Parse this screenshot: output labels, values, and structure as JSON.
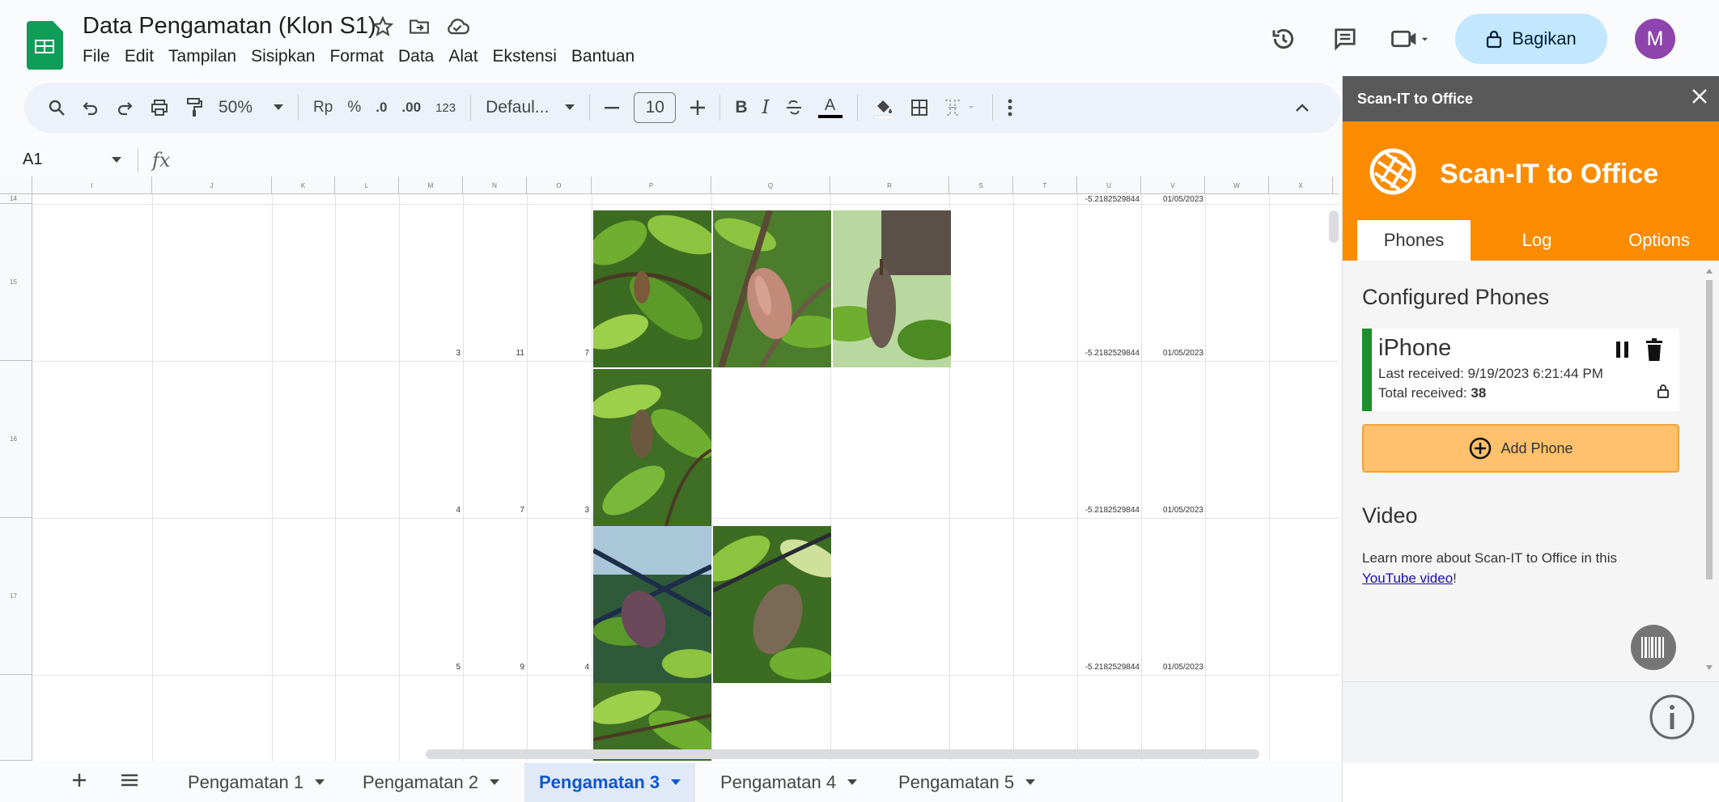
{
  "doc": {
    "title": "Data Pengamatan (Klon S1)",
    "menu": [
      "File",
      "Edit",
      "Tampilan",
      "Sisipkan",
      "Format",
      "Data",
      "Alat",
      "Ekstensi",
      "Bantuan"
    ]
  },
  "header": {
    "share_label": "Bagikan",
    "avatar_initial": "M",
    "icons": [
      "history-icon",
      "comment-icon",
      "video-call-icon",
      "lock-icon"
    ]
  },
  "toolbar": {
    "zoom": "50%",
    "currency": "Rp",
    "percent": "%",
    "decrease_decimal": ".0",
    "increase_decimal": ".00",
    "number_format": "123",
    "font": "Defaul...",
    "font_size": "10",
    "bold": "B",
    "italic": "I",
    "text_color": "A"
  },
  "formula_bar": {
    "name_box": "A1",
    "fx": "fx"
  },
  "grid": {
    "columns": [
      "I",
      "J",
      "K",
      "L",
      "M",
      "N",
      "O",
      "P",
      "Q",
      "R",
      "S",
      "T",
      "U",
      "V",
      "W",
      "X"
    ],
    "rows": [
      "14",
      "15",
      "16",
      "17"
    ],
    "cells": {
      "r14_u": "-5.2182529844",
      "r14_v": "01/05/2023",
      "r15_m": "3",
      "r15_n": "11",
      "r15_o": "7",
      "r15_u": "-5.2182529844",
      "r15_v": "01/05/2023",
      "r16_m": "4",
      "r16_n": "7",
      "r16_o": "3",
      "r16_u": "-5.2182529844",
      "r16_v": "01/05/2023",
      "r17_m": "5",
      "r17_n": "9",
      "r17_o": "4",
      "r17_u": "-5.2182529844",
      "r17_v": "01/05/2023"
    }
  },
  "sheets": {
    "tabs": [
      "Pengamatan 1",
      "Pengamatan 2",
      "Pengamatan 3",
      "Pengamatan 4",
      "Pengamatan 5"
    ],
    "active": "Pengamatan 3"
  },
  "panel": {
    "header_title": "Scan-IT to Office",
    "brand_name": "Scan-IT to Office",
    "tabs": [
      "Phones",
      "Log",
      "Options"
    ],
    "active_tab": "Phones",
    "configured_title": "Configured Phones",
    "phone": {
      "name": "iPhone",
      "last_received": "Last received: 9/19/2023 6:21:44 PM",
      "total_label": "Total received:",
      "total_value": "38"
    },
    "add_phone_label": "Add Phone",
    "video_title": "Video",
    "video_text": "Learn more about Scan-IT to Office in this",
    "video_link": "YouTube video",
    "video_suffix": "!"
  },
  "colors": {
    "brand_orange": "#fb8c00",
    "share_bg": "#c2e7ff",
    "active_tab": "#0b57d0",
    "phone_status": "#1b8f2c",
    "add_phone_bg": "#ffc16b"
  }
}
